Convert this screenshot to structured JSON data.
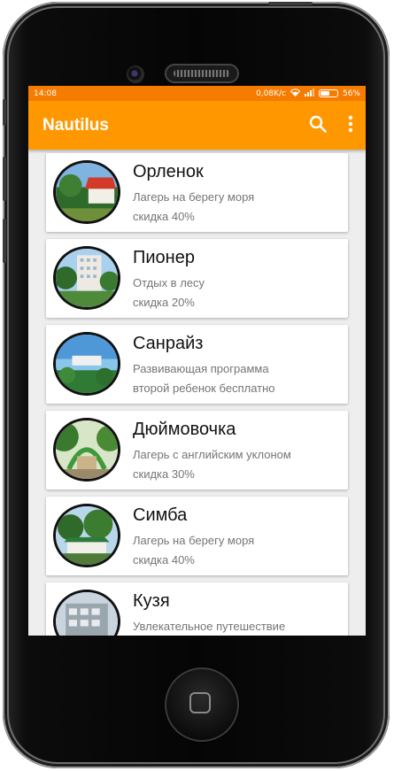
{
  "status_bar": {
    "time": "14:08",
    "speed": "0,08K/c",
    "battery_percent": "56%",
    "battery_level": 0.56
  },
  "toolbar": {
    "title": "Nautilus",
    "search_icon": "search-icon",
    "menu_icon": "more-vert-icon"
  },
  "colors": {
    "status_bar": "#f57c00",
    "toolbar": "#ff9800",
    "background": "#eeeeee"
  },
  "camps": [
    {
      "name": "Орленок",
      "description": "Лагерь на берегу моря",
      "promo": "скидка 40%"
    },
    {
      "name": "Пионер",
      "description": "Отдых в лесу",
      "promo": "скидка 20%"
    },
    {
      "name": "Санрайз",
      "description": "Развивающая программа",
      "promo": "второй ребенок бесплатно"
    },
    {
      "name": "Дюймовочка",
      "description": "Лагерь с английским уклоном",
      "promo": "скидка 30%"
    },
    {
      "name": "Симба",
      "description": "Лагерь на берегу моря",
      "promo": "скидка 40%"
    },
    {
      "name": "Кузя",
      "description": "Увлекательное путешествие",
      "promo": ""
    }
  ]
}
